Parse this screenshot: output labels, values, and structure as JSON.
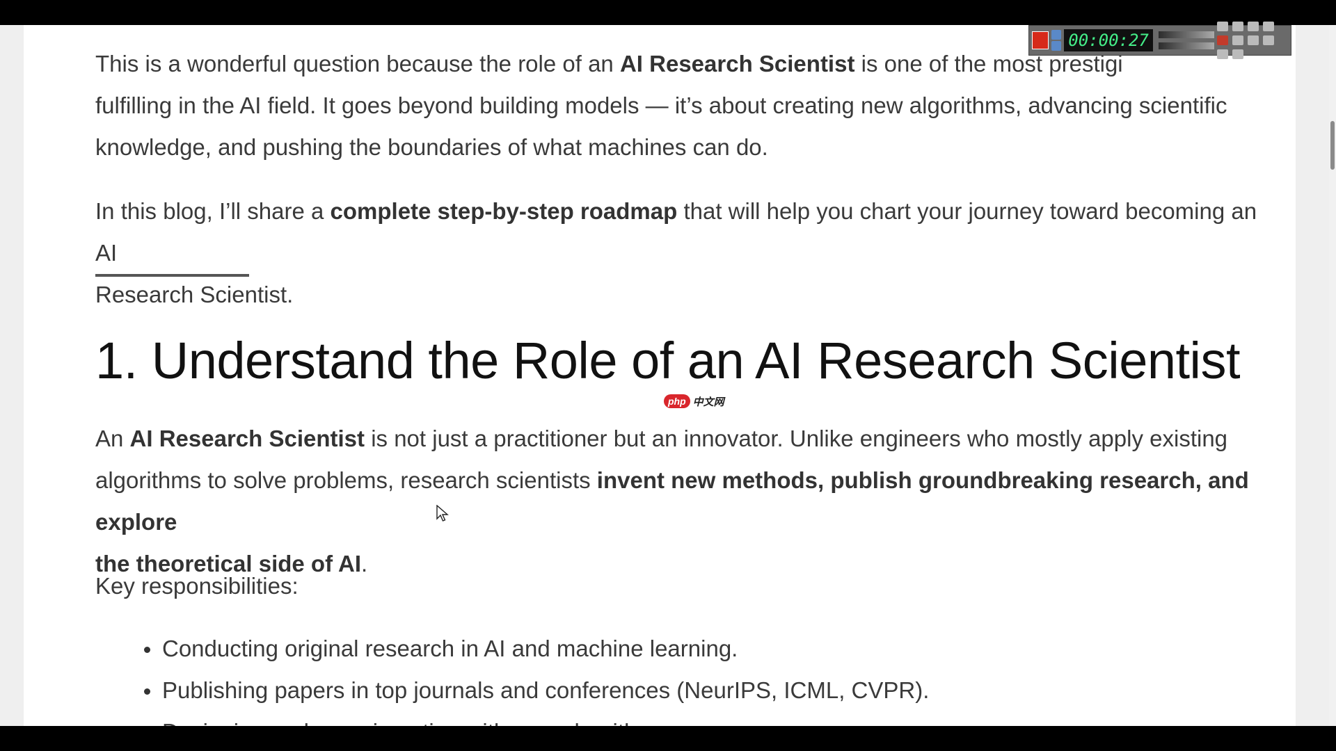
{
  "article": {
    "para1": {
      "a": "This is a wonderful question because the role of an ",
      "b": "AI Research Scientist",
      "c": " is one of the most prestigi",
      "d": "fulfilling in the AI field. It goes beyond building models — it’s about creating new algorithms, advancing scientific",
      "e": "knowledge, and pushing the boundaries of what machines can do."
    },
    "para2": {
      "a": "In this blog, I’ll share a ",
      "b": "complete step-by-step roadmap",
      "c": " that will help you chart your journey toward becoming an AI",
      "d": "Research Scientist."
    },
    "heading": "1. Understand the Role of an AI Research Scientist",
    "para3": {
      "a": "An ",
      "b": "AI Research Scientist",
      "c": " is not just a practitioner but an innovator. Unlike engineers who mostly apply existing",
      "d": "algorithms to solve problems, research scientists ",
      "e": "invent new methods, publish groundbreaking research, and explore",
      "f": "the theoretical side of AI",
      "g": "."
    },
    "responsibilities_label": "Key responsibilities:",
    "responsibilities": [
      "Conducting original research in AI and machine learning.",
      "Publishing papers in top journals and conferences (NeurIPS, ICML, CVPR).",
      "Designing and experimenting with new algorithms."
    ]
  },
  "watermark": {
    "badge": "php",
    "text": "中文网"
  },
  "recorder": {
    "timer": "00:00:27"
  }
}
